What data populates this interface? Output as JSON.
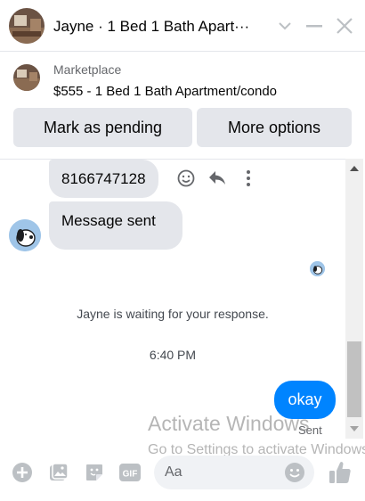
{
  "header": {
    "title": "Jayne · 1 Bed 1 Bath Apart···",
    "icons": [
      "chevron-down-icon",
      "minimize-icon",
      "close-icon"
    ]
  },
  "marketplace": {
    "source": "Marketplace",
    "listing": "$555 - 1 Bed 1 Bath Apartment/condo",
    "buttons": {
      "pending": "Mark as pending",
      "more": "More options"
    }
  },
  "thread": {
    "messages": [
      {
        "direction": "incoming",
        "text": "8166747128"
      },
      {
        "direction": "incoming",
        "text": "Message sent"
      },
      {
        "direction": "outgoing",
        "text": "okay"
      }
    ],
    "system_notice": "Jayne is waiting for your response.",
    "timestamp": "6:40 PM",
    "delivery_status": "Sent"
  },
  "watermark": {
    "title": "Activate Windows",
    "subtitle": "Go to Settings to activate Windows."
  },
  "composer": {
    "placeholder": "Aa",
    "icons": [
      "plus-icon",
      "image-icon",
      "sticker-icon",
      "gif-icon",
      "emoji-icon",
      "thumbs-up-icon"
    ]
  },
  "colors": {
    "accent": "#0084ff",
    "bubble_incoming": "#e4e6eb",
    "button_bg": "#e4e6eb",
    "icon": "#bcc0c4"
  }
}
